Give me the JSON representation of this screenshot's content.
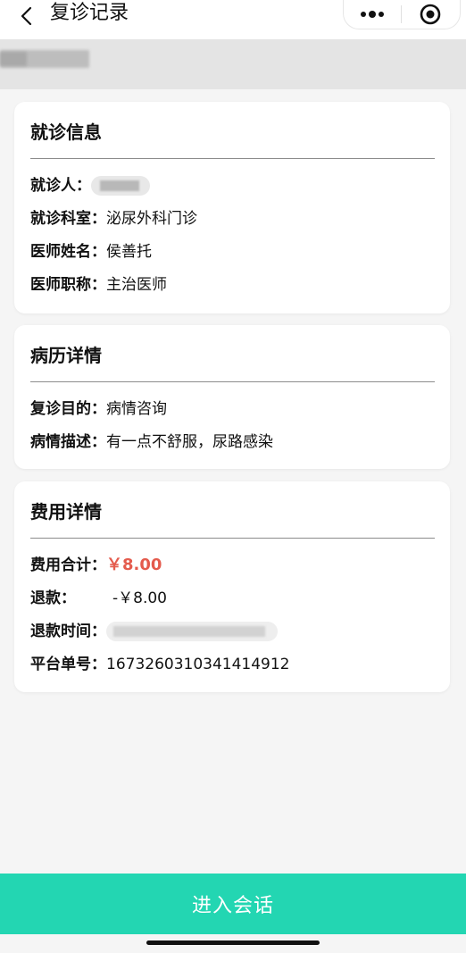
{
  "nav": {
    "title": "复诊记录",
    "back_icon": "chevron-left-icon",
    "more_icon": "more-dots-icon",
    "close_icon": "target-circle-icon"
  },
  "visit_info": {
    "title": "就诊信息",
    "rows": [
      {
        "label": "就诊人：",
        "value": ""
      },
      {
        "label": "就诊科室：",
        "value": "泌尿外科门诊"
      },
      {
        "label": "医师姓名：",
        "value": "侯善托"
      },
      {
        "label": "医师职称：",
        "value": "主治医师"
      }
    ]
  },
  "record": {
    "title": "病历详情",
    "rows": [
      {
        "label": "复诊目的：",
        "value": "病情咨询"
      },
      {
        "label": "病情描述：",
        "value": "有一点不舒服，尿路感染"
      }
    ]
  },
  "fees": {
    "title": "费用详情",
    "rows": [
      {
        "label": "费用合计：",
        "value": "￥8.00"
      },
      {
        "label": "退款：",
        "value": "-￥8.00"
      },
      {
        "label": "退款时间：",
        "value": ""
      },
      {
        "label": "平台单号：",
        "value": "1673260310341414912"
      }
    ]
  },
  "footer": {
    "button_label": "进入会话"
  },
  "colors": {
    "accent": "#23d6b2",
    "price": "#e45b4d"
  }
}
